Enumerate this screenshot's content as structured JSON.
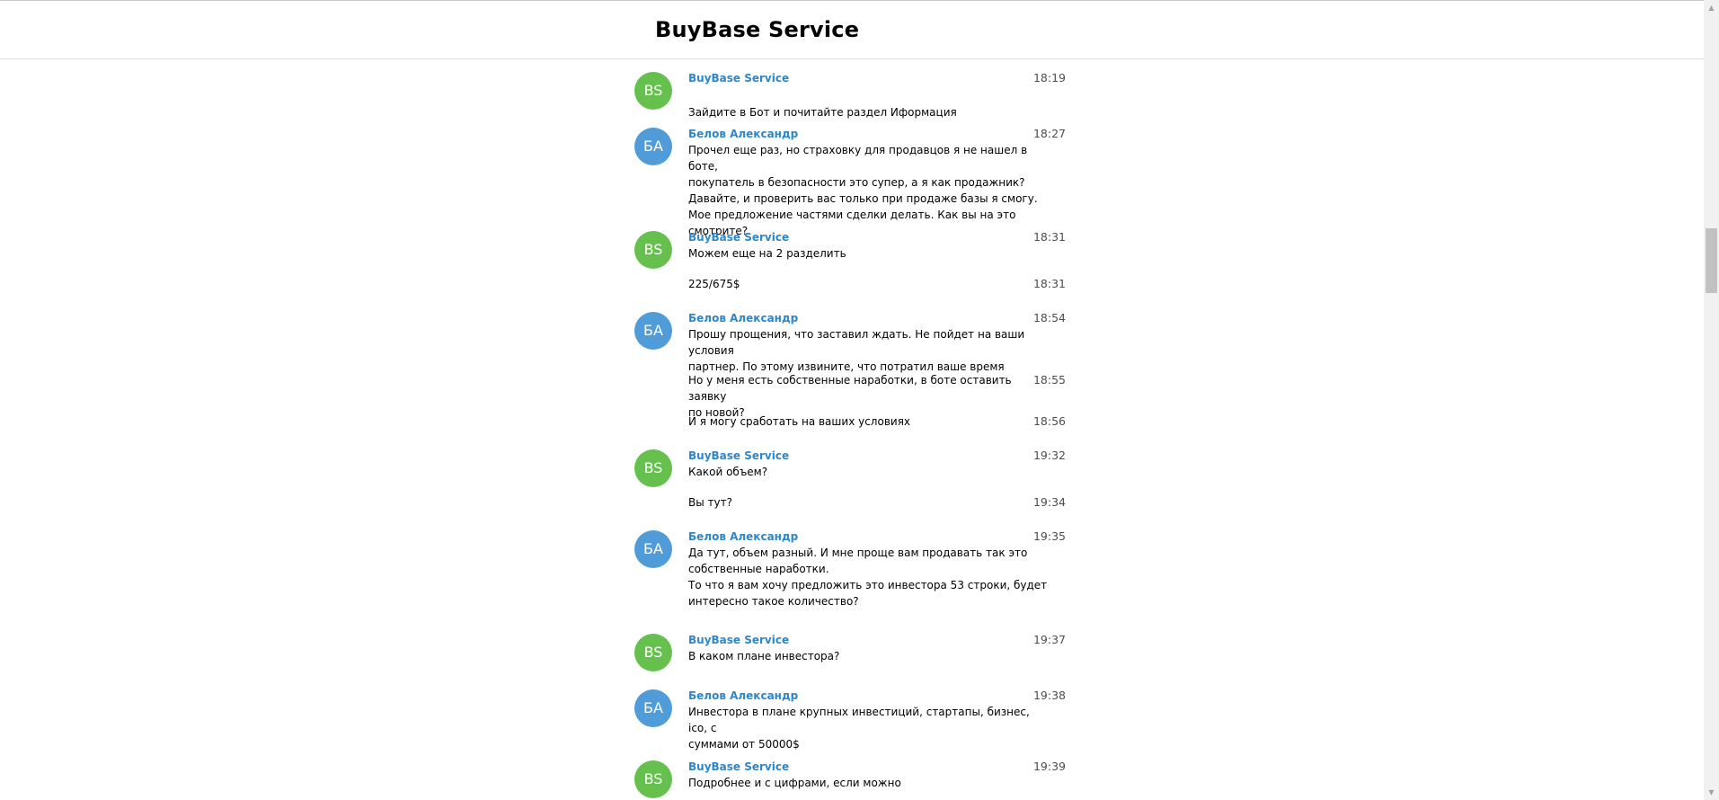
{
  "header": {
    "title": "BuyBase Service"
  },
  "messages": [
    {
      "avatar": "BS",
      "name": "BuyBase Service",
      "time": "18:19",
      "text": "Зайдите в Бот и почитайте раздел Иформация"
    },
    {
      "avatar": "БА",
      "name": "Белов Александр",
      "time": "18:27",
      "text": "Прочел еще раз, но страховку для продавцов я не нашел в боте,\nпокупатель в безопасности это супер, а я как продажник?\nДавайте, и проверить вас только при продаже базы я смогу.\nМое предложение частями сделки делать. Как вы на это смотрите?"
    },
    {
      "avatar": "BS",
      "name": "BuyBase Service",
      "time": "18:31",
      "text": "Можем еще на 2 разделить"
    },
    {
      "time": "18:31",
      "text": "225/675$"
    },
    {
      "avatar": "БА",
      "name": "Белов Александр",
      "time": "18:54",
      "text": "Прошу прощения, что заставил ждать. Не пойдет на ваши условия\nпартнер. По этому извините, что потратил ваше время"
    },
    {
      "time": "18:55",
      "text": "Но у меня есть собственные наработки, в боте оставить заявку\nпо новой?"
    },
    {
      "time": "18:56",
      "text": "И я могу сработать на ваших условиях"
    },
    {
      "avatar": "BS",
      "name": "BuyBase Service",
      "time": "19:32",
      "text": "Какой объем?"
    },
    {
      "time": "19:34",
      "text": "Вы тут?"
    },
    {
      "avatar": "БА",
      "name": "Белов Александр",
      "time": "19:35",
      "text": "Да тут, объем разный. И мне проще вам продавать так это\nсобственные наработки.\nТо что я вам хочу предложить это инвестора 53 строки, будет\nинтересно такое количество?"
    },
    {
      "avatar": "BS",
      "name": "BuyBase Service",
      "time": "19:37",
      "text": "В каком плане инвестора?"
    },
    {
      "avatar": "БА",
      "name": "Белов Александр",
      "time": "19:38",
      "text": "Инвестора в плане крупных инвестиций, стартапы, бизнес, ico, с\nсуммами от 50000$"
    },
    {
      "avatar": "BS",
      "name": "BuyBase Service",
      "time": "19:39",
      "text": "Подробнее и с цифрами, если можно"
    }
  ],
  "colors": {
    "bs_avatar": "#65c04d",
    "ba_avatar": "#4f9cd8",
    "name": "#2f86c8"
  }
}
